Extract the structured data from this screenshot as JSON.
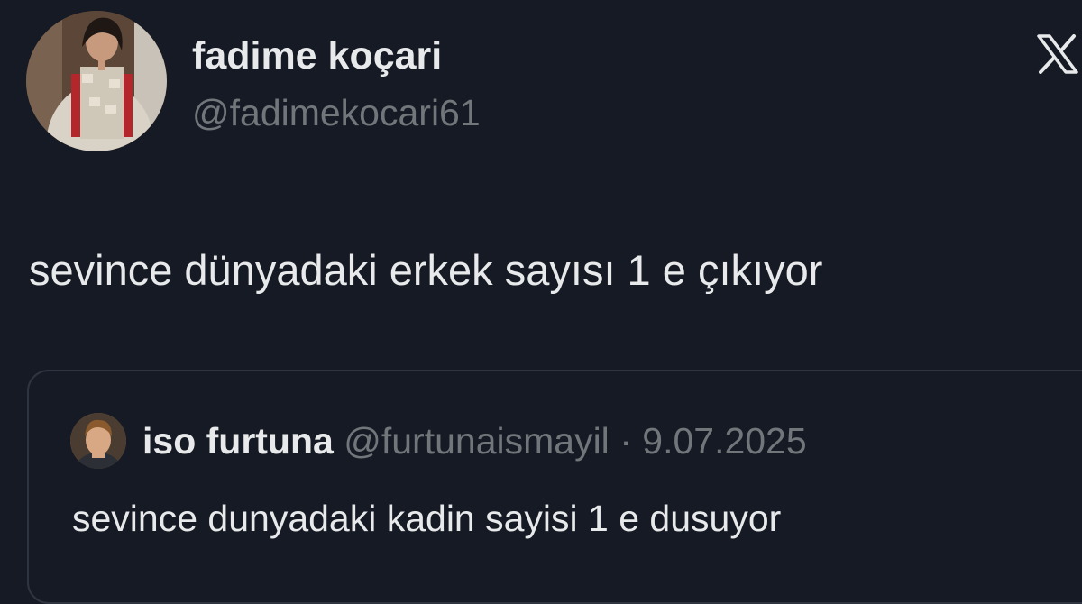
{
  "tweet": {
    "display_name": "fadime koçari",
    "handle": "@fadimekocari61",
    "text": "sevince dünyadaki erkek sayısı 1 e çıkıyor",
    "avatar_icon": "profile-photo"
  },
  "quoted_tweet": {
    "display_name": "iso furtuna",
    "handle": "@furtunaismayil",
    "separator": "·",
    "date": "9.07.2025",
    "text": "sevince dunyadaki kadin sayisi 1 e dusuyor",
    "avatar_icon": "profile-photo"
  },
  "brand": {
    "logo_icon": "x-logo-icon"
  },
  "colors": {
    "background": "#151a24",
    "primary_text": "#e7e9ea",
    "secondary_text": "#71767b",
    "border": "#2f3540"
  }
}
